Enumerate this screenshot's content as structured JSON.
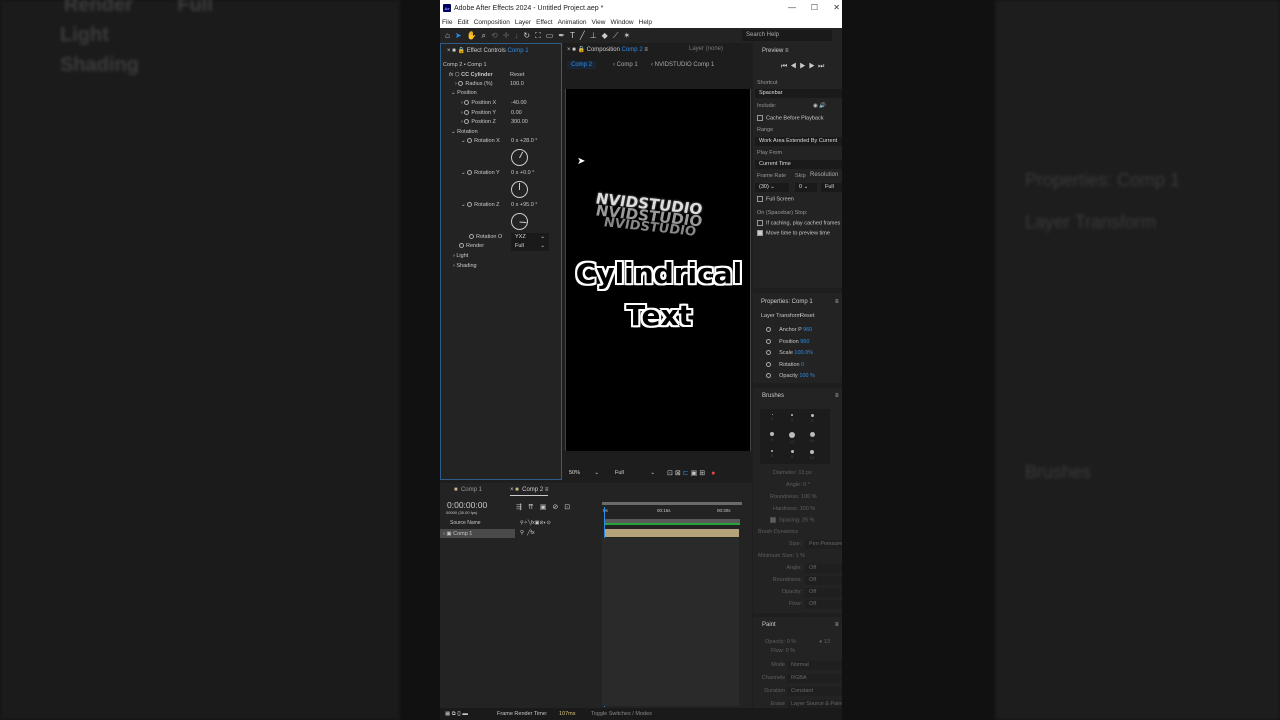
{
  "window": {
    "title": "Adobe After Effects 2024 - Untitled Project.aep *",
    "minimize": "—",
    "maximize": "☐",
    "close": "✕"
  },
  "menu": [
    "File",
    "Edit",
    "Composition",
    "Layer",
    "Effect",
    "Animation",
    "View",
    "Window",
    "Help"
  ],
  "toolbar": {
    "search_placeholder": "Search Help"
  },
  "effect_controls": {
    "tab_label": "Effect Controls",
    "tab_comp": "Comp 1",
    "breadcrumb": "Comp 2 • Comp 1",
    "effect_name": "CC Cylinder",
    "reset": "Reset",
    "radius_label": "Radius (%)",
    "radius": "100.0",
    "position_group": "Position",
    "pos_x_label": "Position X",
    "pos_x": "-40.00",
    "pos_y_label": "Position Y",
    "pos_y": "0.00",
    "pos_z_label": "Position Z",
    "pos_z": "300.00",
    "rotation_group": "Rotation",
    "rot_x_label": "Rotation X",
    "rot_x": "0 x +28.0 °",
    "rot_y_label": "Rotation Y",
    "rot_y": "0 x +0.0 °",
    "rot_z_label": "Rotation Z",
    "rot_z": "0 x +95.0 °",
    "rot_order_label": "Rotation O",
    "rot_order": "YXZ",
    "render_label": "Render",
    "render": "Full",
    "light": "Light",
    "shading": "Shading",
    "dial_angles": [
      28,
      0,
      95
    ]
  },
  "composition": {
    "tab_label": "Composition",
    "tab_comp": "Comp 2",
    "layer_tab": "Layer (none)",
    "breadcrumbs": [
      "Comp 2",
      "Comp 1",
      "NVIDSTUDIO Comp 1"
    ],
    "cylinder_text": "NVIDSTUDIO",
    "title_line1": "Cylindrical",
    "title_line2": "Text",
    "zoom": "50%",
    "resolution": "Full"
  },
  "preview": {
    "title": "Preview",
    "shortcut_label": "Shortcut",
    "shortcut": "Spacebar",
    "include_label": "Include:",
    "cache_label": "Cache Before Playback",
    "range_label": "Range",
    "range": "Work Area Extended By Current",
    "play_from_label": "Play From",
    "play_from": "Current Time",
    "frame_rate_label": "Frame Rate",
    "skip_label": "Skip",
    "resolution_label": "Resolution",
    "frame_rate": "(30)",
    "skip": "0",
    "resolution": "Full",
    "full_screen_label": "Full Screen",
    "stop_label": "On (Spacebar) Stop:",
    "if_caching_label": "If caching, play cached frames",
    "move_time_label": "Move time to preview time",
    "move_time_checked": true
  },
  "properties": {
    "title": "Properties: Comp 1",
    "layer_transform": "Layer Transform",
    "reset": "Reset",
    "items": [
      {
        "label": "Anchor P",
        "value": "960"
      },
      {
        "label": "Position",
        "value": "960"
      },
      {
        "label": "Scale",
        "value": "100.0%"
      },
      {
        "label": "Rotation",
        "value": "0"
      },
      {
        "label": "Opacity",
        "value": "100 %"
      }
    ]
  },
  "brushes": {
    "title": "Brushes",
    "sizes": [
      "1",
      "3",
      "5",
      "9",
      "13",
      "19",
      "5",
      "9",
      "13"
    ],
    "diameter": "Diameter: 13 px",
    "angle": "Angle: 0 °",
    "roundness": "Roundness: 100 %",
    "hardness": "Hardness: 100 %",
    "spacing": "Spacing: 25 %",
    "dynamics": "Brush Dynamics",
    "size_label": "Size:",
    "size": "Pen Pressure",
    "min_size": "Minimum Size: 1 %",
    "dyn": [
      {
        "label": "Angle:",
        "value": "Off"
      },
      {
        "label": "Roundness:",
        "value": "Off"
      },
      {
        "label": "Opacity:",
        "value": "Off"
      },
      {
        "label": "Flow:",
        "value": "Off"
      }
    ]
  },
  "paint": {
    "title": "Paint",
    "opacity": "Opacity: 0 %",
    "flow": "Flow: 0 %",
    "brush_num": "13",
    "rows": [
      {
        "label": "Mode",
        "value": "Normal"
      },
      {
        "label": "Channels",
        "value": "RGBA"
      },
      {
        "label": "Duration",
        "value": "Constant"
      },
      {
        "label": "Erase",
        "value": "Layer Source & Paint"
      }
    ]
  },
  "timeline": {
    "tabs": [
      "Comp 1",
      "Comp 2"
    ],
    "timecode": "0:00:00:00",
    "fps": "00000 (30.00 fps)",
    "source_name": "Source Name",
    "ruler": [
      "0s",
      "00:15s",
      "00:30s"
    ],
    "layer_name": "Comp 1"
  },
  "status": {
    "render_label": "Frame Render Time:",
    "render_time": "107ms",
    "toggle": "Toggle Switches / Modes"
  },
  "colors": {
    "accent": "#2d8ceb",
    "layer_bar": "#b5a27a",
    "work_area": "#27a33a"
  }
}
